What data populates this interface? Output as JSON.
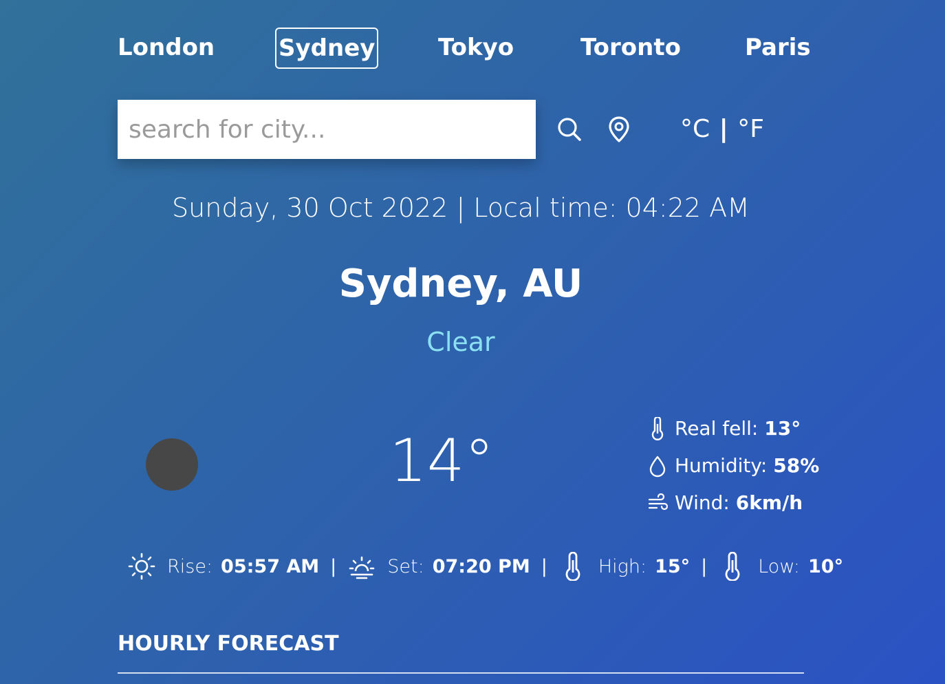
{
  "cities": [
    "London",
    "Sydney",
    "Tokyo",
    "Toronto",
    "Paris"
  ],
  "active_city": "Sydney",
  "search": {
    "placeholder": "search for city..."
  },
  "icons": {
    "search": "search-icon",
    "location": "location-pin-icon",
    "weather": "weather-condition-icon",
    "thermometer": "thermometer-icon",
    "humidity": "droplet-icon",
    "wind": "wind-icon",
    "sunrise": "sunrise-icon",
    "sunset": "sunset-icon"
  },
  "units": {
    "celsius": "°C",
    "separator": "|",
    "fahrenheit": "°F"
  },
  "date_line": "Sunday, 30 Oct 2022 | Local time: 04:22 AM",
  "location": "Sydney, AU",
  "condition": "Clear",
  "temperature": "14°",
  "details": {
    "real_feel_label": "Real fell:",
    "real_feel_value": "13°",
    "humidity_label": "Humidity:",
    "humidity_value": "58%",
    "wind_label": "Wind:",
    "wind_value": "6km/h"
  },
  "sun": {
    "rise_label": "Rise:",
    "rise_value": "05:57 AM",
    "set_label": "Set:",
    "set_value": "07:20 PM",
    "high_label": "High:",
    "high_value": "15°",
    "low_label": "Low:",
    "low_value": "10°",
    "separator": "|"
  },
  "forecast_title": "HOURLY FORECAST",
  "colors": {
    "background_start": "#31719a",
    "background_end": "#2b52c4",
    "condition": "#8be0f2",
    "weather_icon_placeholder": "#474747"
  }
}
